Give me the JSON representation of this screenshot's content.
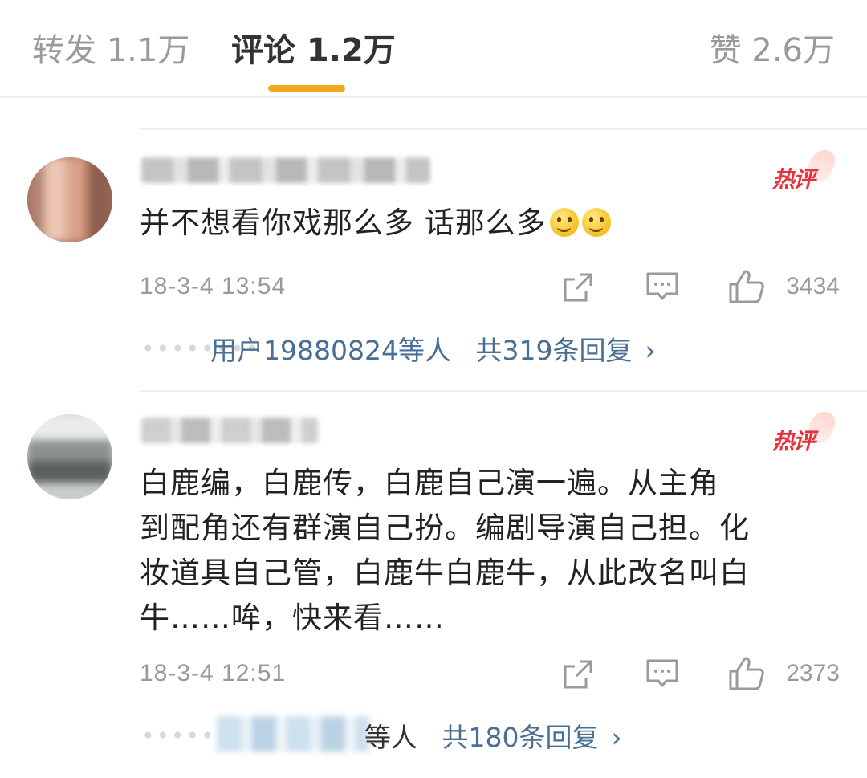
{
  "tabs": {
    "repost": "转发 1.1万",
    "comments": "评论 1.2万",
    "likes": "赞 2.6万"
  },
  "comments": [
    {
      "hot_label": "热评",
      "text": "并不想看你戏那么多 话那么多",
      "time": "18-3-4 13:54",
      "likes": "3434",
      "reply_users": "用户19880824等人",
      "reply_total": "共319条回复"
    },
    {
      "hot_label": "热评",
      "text_lines": [
        "白鹿编，白鹿传，白鹿自己演一遍。从主角",
        "到配角还有群演自己扮。编剧导演自己担。化",
        "妆道具自己管，白鹿牛白鹿牛，从此改名叫白",
        "牛……哞，快来看……"
      ],
      "time": "18-3-4 12:51",
      "likes": "2373",
      "reply_users": "等人",
      "reply_total": "共180条回复"
    }
  ],
  "icons": {
    "share": "share-icon",
    "comment": "comment-icon",
    "like": "thumbs-up-icon",
    "chevron": "chevron-right-icon"
  },
  "colors": {
    "tab_indicator": "#f2a81e",
    "link": "#4a6f95",
    "hot_badge": "#e5333d",
    "meta": "#9a9a9a"
  }
}
